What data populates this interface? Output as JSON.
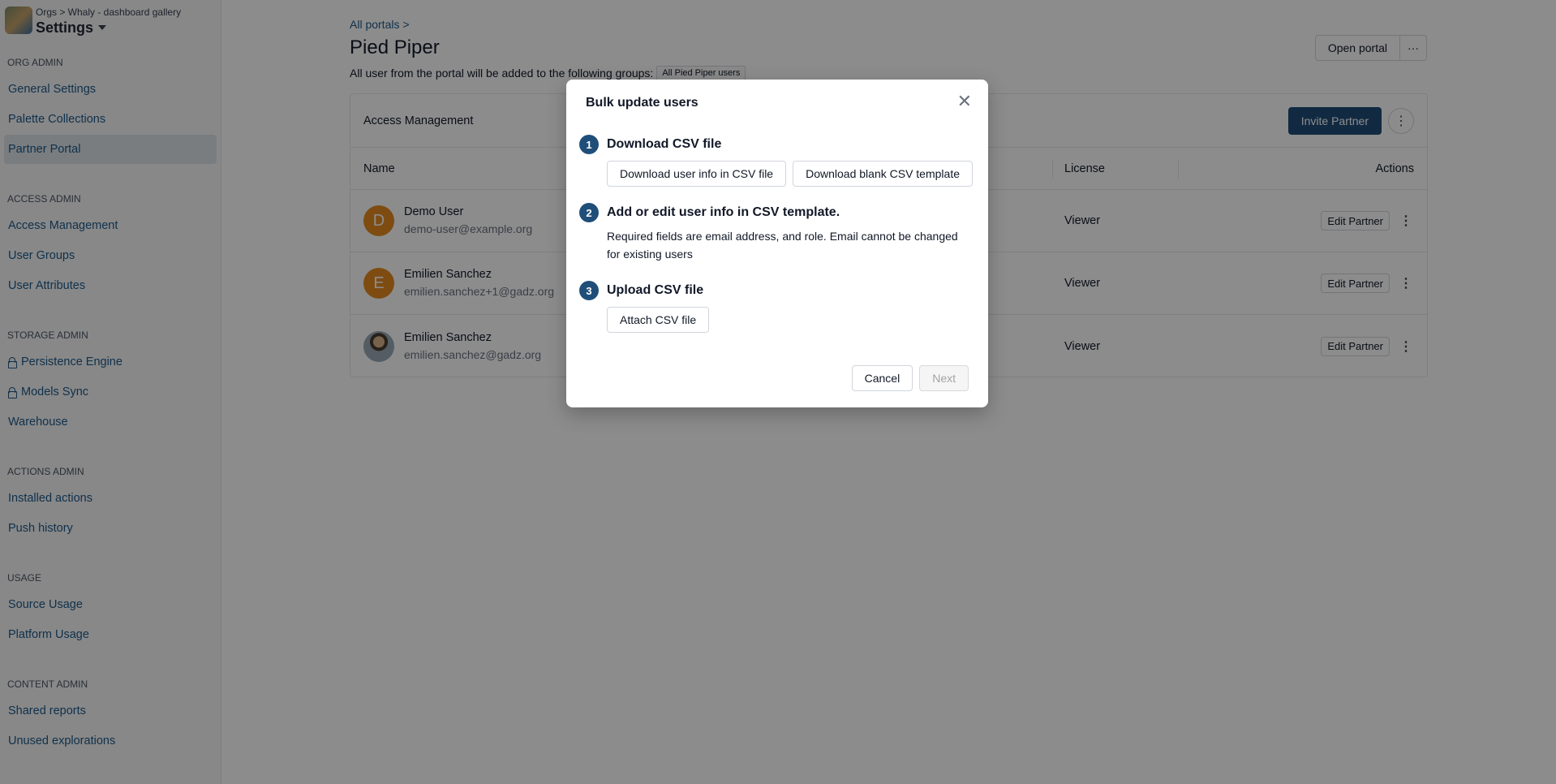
{
  "sidebar": {
    "org_breadcrumb": "Orgs > Whaly - dashboard gallery",
    "org_title": "Settings",
    "sections": [
      {
        "label": "ORG ADMIN",
        "items": [
          {
            "label": "General Settings"
          },
          {
            "label": "Palette Collections"
          },
          {
            "label": "Partner Portal",
            "active": true
          }
        ]
      },
      {
        "label": "ACCESS ADMIN",
        "items": [
          {
            "label": "Access Management"
          },
          {
            "label": "User Groups"
          },
          {
            "label": "User Attributes"
          }
        ]
      },
      {
        "label": "STORAGE ADMIN",
        "items": [
          {
            "label": "Persistence Engine",
            "locked": true
          },
          {
            "label": "Models Sync",
            "locked": true
          },
          {
            "label": "Warehouse"
          }
        ]
      },
      {
        "label": "ACTIONS ADMIN",
        "items": [
          {
            "label": "Installed actions"
          },
          {
            "label": "Push history"
          }
        ]
      },
      {
        "label": "USAGE",
        "items": [
          {
            "label": "Source Usage"
          },
          {
            "label": "Platform Usage"
          }
        ]
      },
      {
        "label": "CONTENT ADMIN",
        "items": [
          {
            "label": "Shared reports"
          },
          {
            "label": "Unused explorations"
          }
        ]
      }
    ]
  },
  "main": {
    "breadcrumb": "All portals >",
    "title": "Pied Piper",
    "open_portal_label": "Open portal",
    "more_label": "···",
    "groups_text": "All user from the portal will be added to the following groups:",
    "group_tag": "All Pied Piper users",
    "card": {
      "title": "Access Management",
      "invite_label": "Invite Partner",
      "columns": {
        "name": "Name",
        "license": "License",
        "actions": "Actions"
      },
      "rows": [
        {
          "initial": "D",
          "name": "Demo User",
          "email": "demo-user@example.org",
          "license": "Viewer",
          "action": "Edit Partner"
        },
        {
          "initial": "E",
          "name": "Emilien Sanchez",
          "email": "emilien.sanchez+1@gadz.org",
          "license": "Viewer",
          "action": "Edit Partner"
        },
        {
          "initial": "",
          "name": "Emilien Sanchez",
          "email": "emilien.sanchez@gadz.org",
          "license": "Viewer",
          "action": "Edit Partner"
        }
      ]
    }
  },
  "modal": {
    "title": "Bulk update users",
    "steps": [
      {
        "num": "1",
        "title": "Download CSV file",
        "buttons": [
          "Download user info in CSV file",
          "Download blank CSV template"
        ]
      },
      {
        "num": "2",
        "title": "Add or edit user info in CSV template.",
        "desc": "Required fields are email address, and role. Email cannot be changed for existing users"
      },
      {
        "num": "3",
        "title": "Upload CSV file",
        "buttons": [
          "Attach CSV file"
        ]
      }
    ],
    "cancel_label": "Cancel",
    "next_label": "Next"
  }
}
